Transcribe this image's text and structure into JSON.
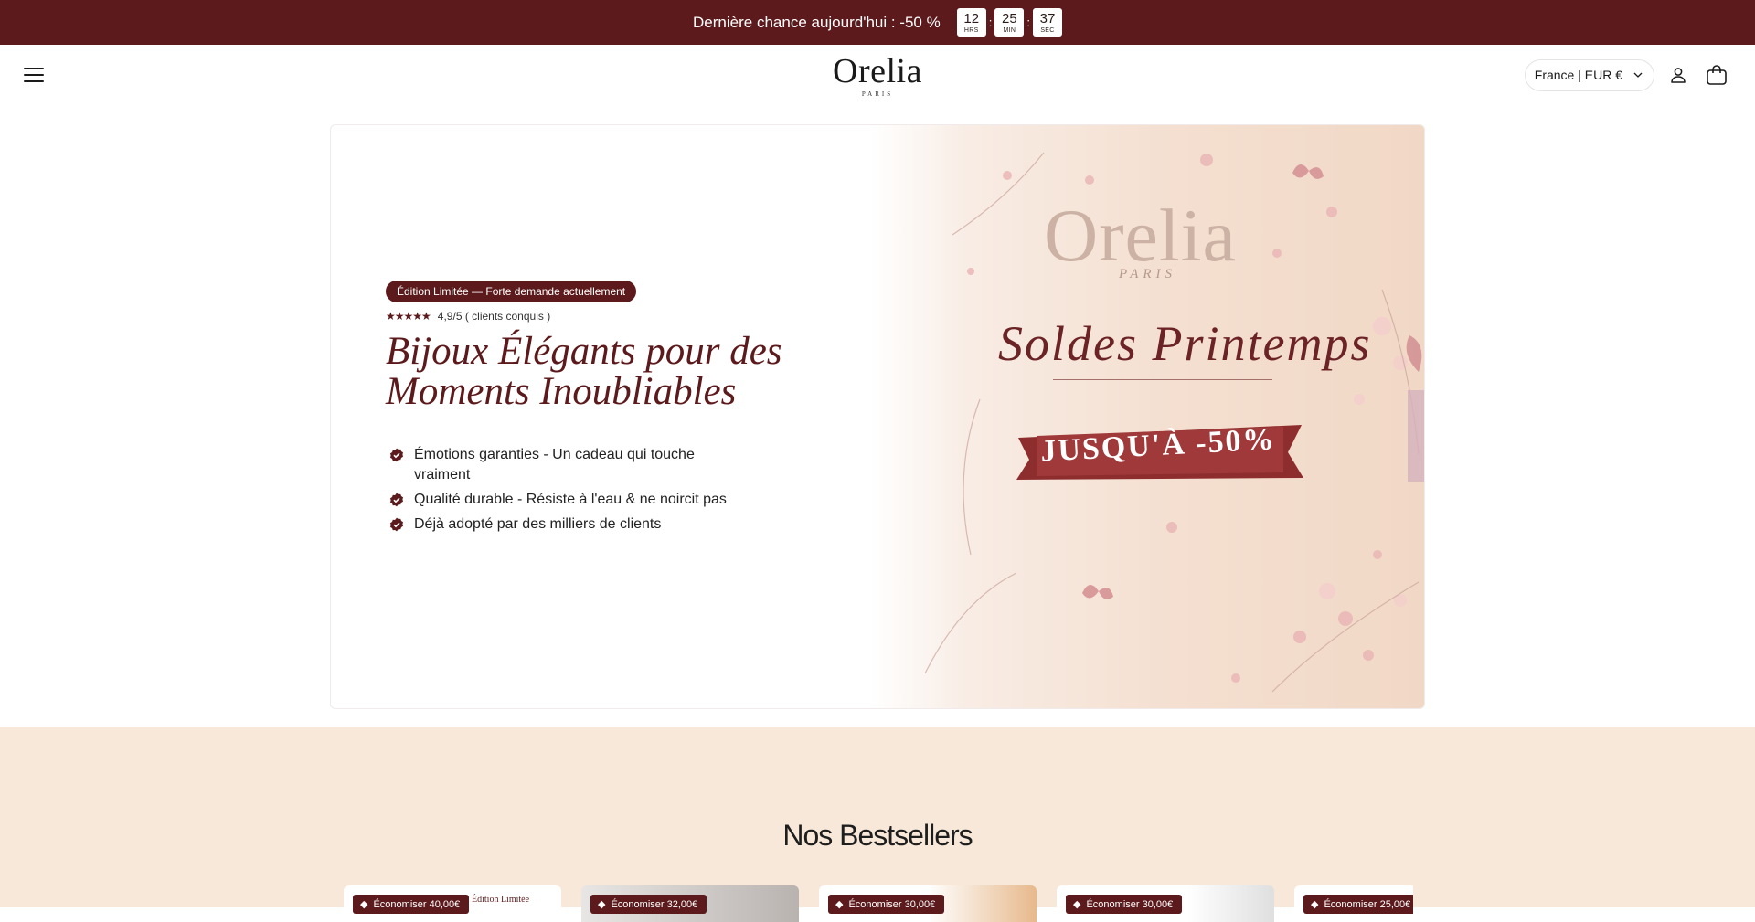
{
  "announcement": {
    "text": "Dernière chance aujourd'hui : -50 %",
    "timer": [
      {
        "value": "12",
        "label": "HRS"
      },
      {
        "value": "25",
        "label": "MIN"
      },
      {
        "value": "37",
        "label": "SEC"
      }
    ],
    "separator": ":"
  },
  "header": {
    "logo": "Orelia",
    "logo_sub": "PARIS",
    "locale": "France | EUR €",
    "icons": [
      "menu-icon",
      "chevron-down-icon",
      "account-icon",
      "cart-icon"
    ]
  },
  "hero": {
    "badge": "Édition Limitée — Forte demande actuellement",
    "stars": "★★★★★",
    "rating_text": "4,9/5 ( clients conquis )",
    "title_line1": "Bijoux Élégants pour des",
    "title_line2": "Moments Inoubliables",
    "features": [
      "Émotions garanties - Un cadeau qui touche vraiment",
      "Qualité durable - Résiste à l'eau & ne noircit pas",
      "Déjà adopté par des milliers de clients"
    ],
    "banner": {
      "logo": "Orelia",
      "logo_sub": "PARIS",
      "headline": "Soldes Printemps",
      "ribbon": "JUSQU'À -50%"
    }
  },
  "bestsellers": {
    "title": "Nos Bestsellers",
    "cards": [
      {
        "badge": "Économiser 40,00€",
        "note": "Édition Limitée"
      },
      {
        "badge": "Économiser 32,00€",
        "note": ""
      },
      {
        "badge": "Économiser 30,00€",
        "note": ""
      },
      {
        "badge": "Économiser 30,00€",
        "note": ""
      },
      {
        "badge": "Économiser 25,00€",
        "note": ""
      }
    ]
  },
  "colors": {
    "brand": "#5c1a1c",
    "cream": "#f8e8d9",
    "banner_peach": "#f4dfd0"
  }
}
